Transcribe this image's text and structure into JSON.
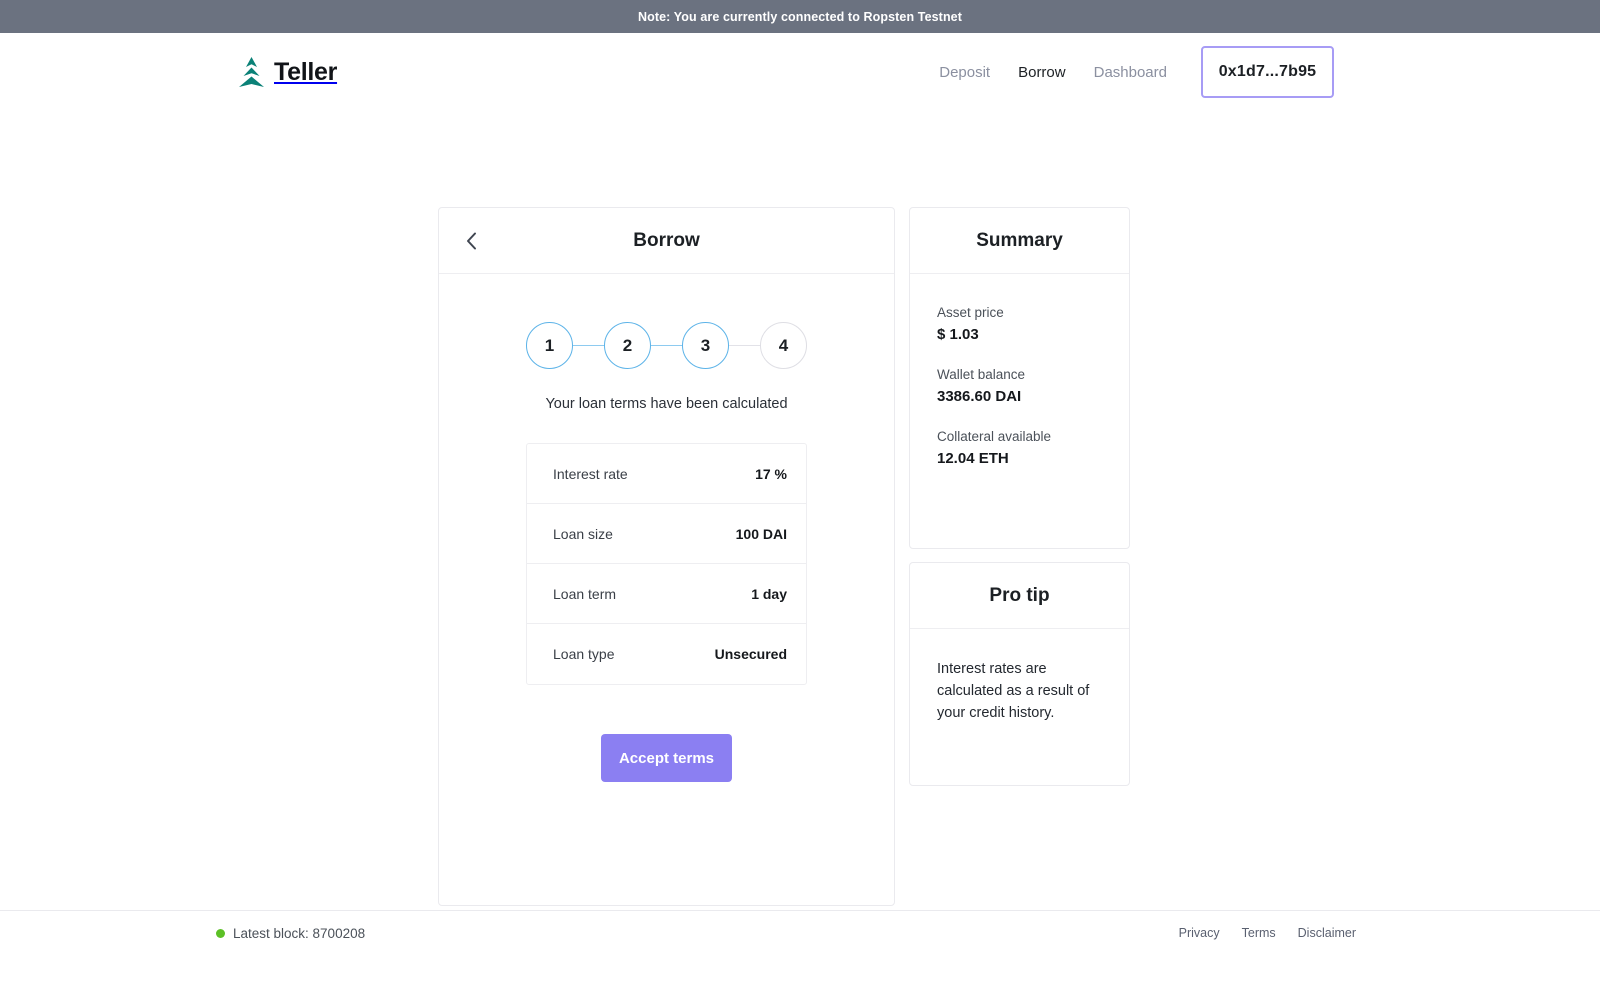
{
  "banner": {
    "note": "Note: You are currently connected to Ropsten Testnet",
    "background": "#6b7280"
  },
  "header": {
    "brand_name": "Teller",
    "brand_logo_icon": "teller-tree-logo-icon",
    "brand_color": "#0b8177",
    "nav": [
      {
        "label": "Deposit",
        "active": false
      },
      {
        "label": "Borrow",
        "active": true
      },
      {
        "label": "Dashboard",
        "active": false
      }
    ],
    "wallet": {
      "address_label": "0x1d7...7b95",
      "border_color": "#a79cf5"
    }
  },
  "borrow_card": {
    "back_icon": "chevron-left-icon",
    "title": "Borrow",
    "stepper": {
      "steps": [
        {
          "number": "1",
          "state": "done"
        },
        {
          "number": "2",
          "state": "done"
        },
        {
          "number": "3",
          "state": "done"
        },
        {
          "number": "4",
          "state": "pending"
        }
      ],
      "active_color": "#5cb3e8",
      "inactive_color": "#dedee4"
    },
    "caption": "Your loan terms have been calculated",
    "terms": [
      {
        "label": "Interest rate",
        "value": "17 %"
      },
      {
        "label": "Loan size",
        "value": "100 DAI"
      },
      {
        "label": "Loan term",
        "value": "1 day"
      },
      {
        "label": "Loan type",
        "value": "Unsecured"
      }
    ],
    "accept_button": {
      "label": "Accept terms",
      "color": "#8b7ff2"
    }
  },
  "summary_card": {
    "title": "Summary",
    "items": [
      {
        "key": "Asset price",
        "value": "$ 1.03"
      },
      {
        "key": "Wallet balance",
        "value": "3386.60 DAI"
      },
      {
        "key": "Collateral available",
        "value": "12.04 ETH"
      }
    ]
  },
  "protip_card": {
    "title": "Pro tip",
    "text": "Interest rates are calculated as a result of your credit history."
  },
  "footer": {
    "status_dot_icon": "green-status-dot-icon",
    "status_color": "#5cc026",
    "block_text": "Latest block: 8700208",
    "links": [
      "Privacy",
      "Terms",
      "Disclaimer"
    ]
  }
}
